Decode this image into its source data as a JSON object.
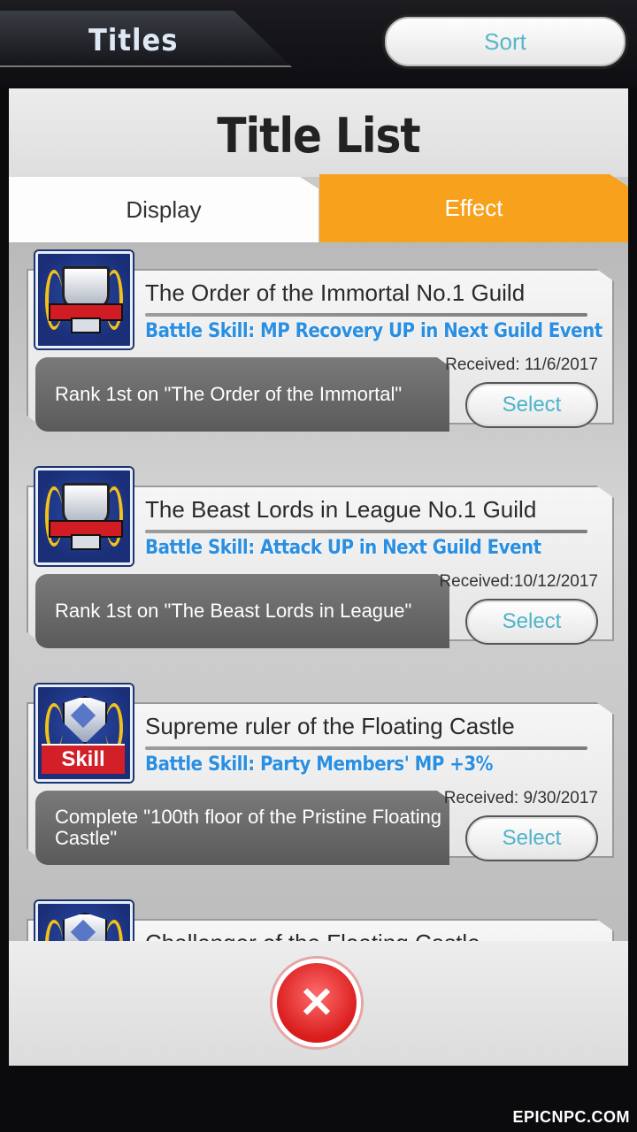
{
  "header": {
    "tab_label": "Titles",
    "sort_label": "Sort"
  },
  "panel": {
    "title": "Title List",
    "tabs": [
      {
        "label": "Display",
        "active": false
      },
      {
        "label": "Effect",
        "active": true
      }
    ]
  },
  "cards": [
    {
      "title": "The Order of the Immortal No.1 Guild",
      "skill_prefix": "Battle Skill:",
      "skill": "MP Recovery UP in Next Guild Event",
      "condition": "Rank 1st on \"The Order of the Immortal\"",
      "received": "Received: 11/6/2017",
      "button": "Select",
      "icon": "guild-trophy-icon"
    },
    {
      "title": "The Beast Lords in League No.1 Guild",
      "skill_prefix": "Battle Skill:",
      "skill": "Attack UP in Next Guild Event",
      "condition": "Rank 1st on \"The Beast Lords in League\"",
      "received": "Received:10/12/2017",
      "button": "Select",
      "icon": "guild-trophy-icon"
    },
    {
      "title": "Supreme ruler of the Floating Castle",
      "skill_prefix": "Battle Skill:",
      "skill": "Party Members' MP +3%",
      "condition": "Complete  \"100th floor of the Pristine Floating Castle\"",
      "received": "Received: 9/30/2017",
      "button": "Select",
      "icon": "skill-shield-icon",
      "icon_label": "Skill"
    },
    {
      "title": "Challenger of the Floating Castle",
      "icon": "skill-shield-icon"
    }
  ],
  "footer": {
    "close_icon": "close-icon"
  },
  "watermark": "EPICNPC.COM",
  "colors": {
    "accent": "#f7a11c",
    "skill_text": "#2a8fe0",
    "select_text": "#4db3c9",
    "close": "#d91c1c"
  }
}
